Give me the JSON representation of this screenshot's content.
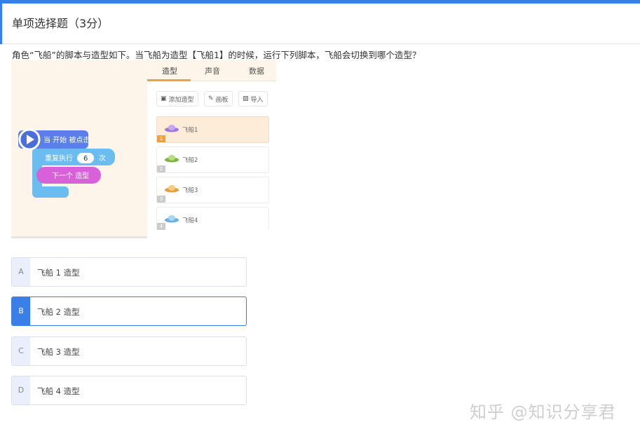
{
  "header": {
    "title": "单项选择题（3分）"
  },
  "question": "角色“飞船”的脚本与造型如下。当飞船为造型【飞船1】的时候，运行下列脚本，飞船会切换到哪个造型？",
  "figure": {
    "tabs": [
      "造型",
      "声音",
      "数据"
    ],
    "active_tab": "造型",
    "tools": [
      {
        "label": "添加造型",
        "icon": "costume-add-icon"
      },
      {
        "label": "画板",
        "icon": "pencil-icon"
      },
      {
        "label": "导入",
        "icon": "image-import-icon"
      }
    ],
    "costumes": [
      {
        "name": "飞船1",
        "num": "1",
        "selected": true,
        "color": "#a07ad8"
      },
      {
        "name": "飞船2",
        "num": "2",
        "selected": false,
        "color": "#8bc34a"
      },
      {
        "name": "飞船3",
        "num": "3",
        "selected": false,
        "color": "#e0a040"
      },
      {
        "name": "飞船4",
        "num": "4",
        "selected": false,
        "color": "#6ab0e0"
      }
    ],
    "blocks": {
      "hat": "当 开始 被点击",
      "repeat_label": "重复执行",
      "repeat_count": "6",
      "repeat_unit": "次",
      "next_costume": "下一个 造型"
    }
  },
  "options": [
    {
      "letter": "A",
      "text": "飞船 1 造型",
      "selected": false
    },
    {
      "letter": "B",
      "text": "飞船 2 造型",
      "selected": true
    },
    {
      "letter": "C",
      "text": "飞船 3 造型",
      "selected": false
    },
    {
      "letter": "D",
      "text": "飞船 4 造型",
      "selected": false
    }
  ],
  "watermark": "知乎 @知识分享君",
  "colors": {
    "accent": "#3a7ee8",
    "event_block": "#5b7fe8",
    "control_block": "#6bbcf0",
    "looks_block": "#d860d8"
  }
}
